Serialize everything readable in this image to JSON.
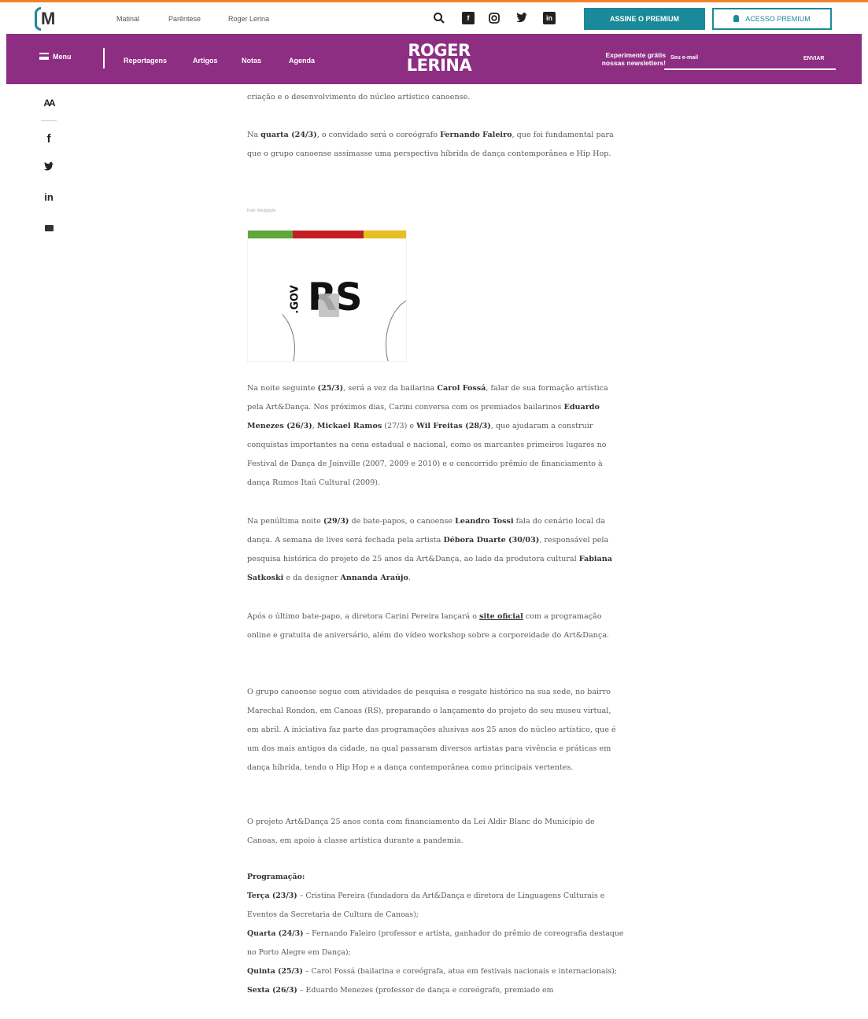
{
  "colors": {
    "accent_top_line": "#f0822a",
    "brand_teal": "#1a8a9a",
    "nav_purple": "#8e2e83"
  },
  "topbar": {
    "logo_letter": "M",
    "links": [
      "Matinal",
      "Parêntese",
      "Roger Lerina"
    ],
    "icons": [
      "search-icon",
      "facebook-icon",
      "instagram-icon",
      "twitter-icon",
      "linkedin-icon"
    ],
    "premium_button": "ASSINE O PREMIUM",
    "access_button": "ACESSO PREMIUM"
  },
  "navbar": {
    "menu_label": "Menu",
    "links": [
      "Reportagens",
      "Artigos",
      "Notas",
      "Agenda"
    ],
    "brand_line1": "ROGER",
    "brand_line2": "LERINA",
    "newsletter_line1": "Experimente grátis",
    "newsletter_line2": "nossas newsletters!",
    "email_placeholder": "Seu e-mail",
    "send_label": "ENVIAR"
  },
  "share": {
    "font_size_label": "AA",
    "icons": [
      "font-size-icon",
      "facebook-icon",
      "twitter-icon",
      "linkedin-icon",
      "email-icon"
    ]
  },
  "article": {
    "p0": "criação e o desenvolvimento do núcleo artístico canoense.",
    "p1_a": "Na ",
    "p1_b": "quarta (24/3)",
    "p1_c": ", o convidado será o coreógrafo ",
    "p1_d": "Fernando Faleiro",
    "p1_e": ", que foi fundamental para que o grupo canoense assimasse uma perspectiva híbrida de dança contemporânea e Hip Hop.",
    "caption": "Foto: divulgação",
    "image": {
      "gov_label": ".GOV",
      "rs_label": "RS"
    },
    "p2_a": "Na noite seguinte ",
    "p2_b": "(25/3)",
    "p2_c": ", será a vez da bailarina ",
    "p2_d": "Carol Fossá",
    "p2_e": ", falar de sua formação artística pela Art&Dança. Nos próximos dias, Carini conversa com os premiados bailarinos ",
    "p2_f": "Eduardo Menezes (26/3)",
    "p2_g": ", ",
    "p2_h": "Mickael Ramos",
    "p2_i": " (27/3) e ",
    "p2_j": "Wil Freitas (28/3)",
    "p2_k": ", que ajudaram a construir conquistas importantes na cena estadual e nacional, como os marcantes primeiros lugares no Festival de Dança de Joinville (2007, 2009 e 2010) e o concorrido prêmio de financiamento à dança Rumos Itaú Cultural (2009).",
    "p3_a": "Na penúltima noite ",
    "p3_b": "(29/3)",
    "p3_c": " de bate-papos, o canoense ",
    "p3_d": "Leandro Tossi",
    "p3_e": " fala do cenário local da dança. A semana de lives será fechada pela artista ",
    "p3_f": "Débora Duarte (30/03)",
    "p3_g": ", responsável pela pesquisa histórica do projeto de 25 anos da Art&Dança, ao lado da produtora cultural ",
    "p3_h": "Fabiana Satkoski",
    "p3_i": " e da designer ",
    "p3_j": "Annanda Araújo",
    "p3_k": ".",
    "p4_a": "Após o último bate-papo, a diretora Carini Pereira lançará o ",
    "p4_link": "site oficial",
    "p4_b": " com a programação online e gratuita de aniversário, além do vídeo workshop sobre a corporeidade do Art&Dança.",
    "p5": "O grupo canoense segue com atividades de pesquisa e resgate histórico na sua sede, no bairro Marechal Rondon, em Canoas (RS), preparando o lançamento do projeto do seu museu virtual, em abril. A iniciativa faz parte das programações alusivas aos 25 anos do núcleo artístico, que é um dos mais antigos da cidade, na qual passaram diversos artistas para vivência e práticas em dança híbrida, tendo o Hip Hop e a dança contemporânea como principais vertentes.",
    "p6": "O projeto Art&Dança 25 anos conta com financiamento da Lei Aldir Blanc do Município de Canoas, em apoio à classe artística durante a pandemia.",
    "prog_title": "Programação:",
    "prog": [
      {
        "day": "Terça (23/3)",
        "text": " – Cristina Pereira (fundadora da Art&Dança e diretora de Linguagens Culturais e Eventos da Secretaria de Cultura de Canoas);"
      },
      {
        "day": "Quarta (24/3)",
        "text": " – Fernando Faleiro (professor e artista, ganhador do prêmio de coreografia destaque no Porto Alegre em Dança);"
      },
      {
        "day": "Quinta (25/3)",
        "text": " – Carol Fossá (bailarina e coreógrafa, atua em festivais nacionais e internacionais);"
      },
      {
        "day": "Sexta (26/3)",
        "text": " – Eduardo Menezes (professor de dança e coreógrafo, premiado em"
      }
    ]
  }
}
